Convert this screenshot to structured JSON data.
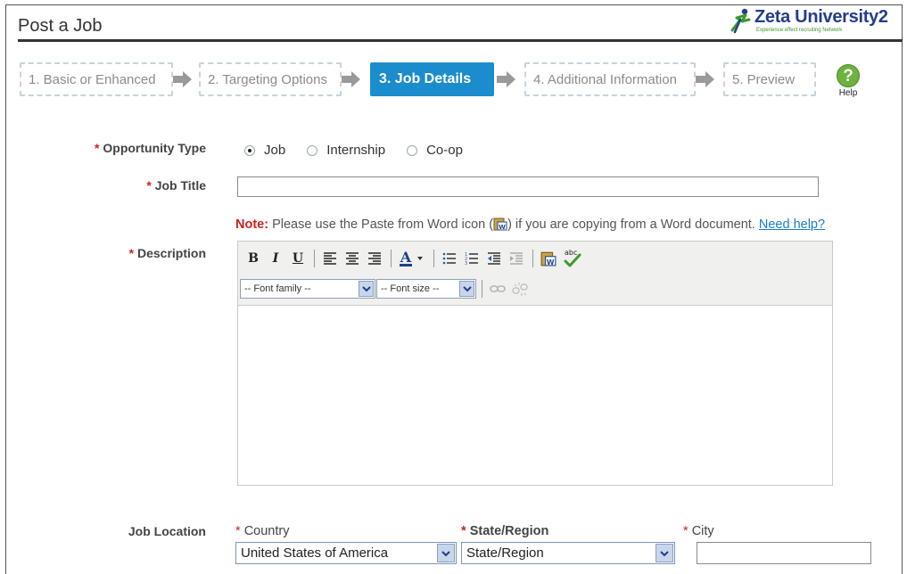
{
  "header": {
    "title": "Post a Job",
    "logo_name": "Zeta University2",
    "logo_tagline": "Experience effect recruiting Network"
  },
  "steps": [
    {
      "label": "1. Basic or Enhanced",
      "active": false
    },
    {
      "label": "2. Targeting Options",
      "active": false
    },
    {
      "label": "3. Job Details",
      "active": true
    },
    {
      "label": "4. Additional Information",
      "active": false
    },
    {
      "label": "5. Preview",
      "active": false
    }
  ],
  "help": {
    "label": "Help",
    "glyph": "?"
  },
  "form": {
    "required_mark": "*",
    "opportunity_type": {
      "label": "Opportunity Type",
      "options": [
        "Job",
        "Internship",
        "Co-op"
      ],
      "selected": "Job"
    },
    "job_title": {
      "label": "Job Title",
      "value": ""
    },
    "note": {
      "prefix": "Note:",
      "text_before": " Please use the Paste from Word icon (",
      "text_after": ") if you are copying from a Word document. ",
      "link": "Need help?"
    },
    "description": {
      "label": "Description",
      "font_family_placeholder": "-- Font family --",
      "font_size_placeholder": "-- Font size --",
      "body": ""
    },
    "location": {
      "label": "Job Location",
      "country_label": "Country",
      "country_value": "United States of America",
      "state_label": "State/Region",
      "state_value": "State/Region",
      "city_label": "City",
      "city_value": ""
    }
  },
  "colors": {
    "active_step": "#1c8dcc",
    "required": "#cc2222",
    "link": "#1a7fd0",
    "help_green": "#6cb33f",
    "logo_blue": "#233e8c"
  }
}
